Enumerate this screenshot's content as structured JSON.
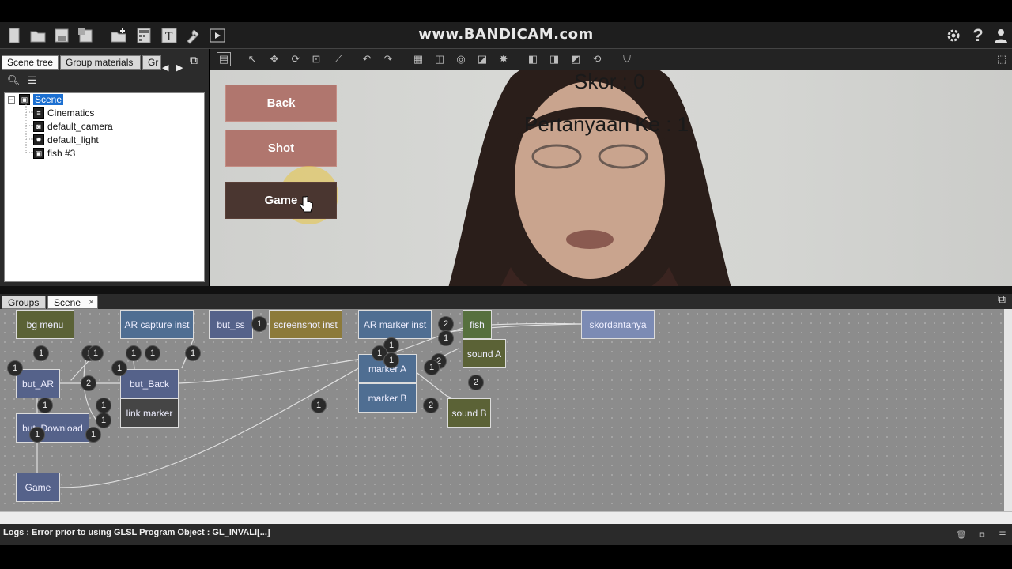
{
  "watermark": "www.BANDICAM.com",
  "toolbar": {
    "icons": [
      "new-file-icon",
      "open-folder-icon",
      "save-icon",
      "save-as-icon",
      "import-icon",
      "calculator-icon",
      "text-tool-icon",
      "wrench-icon",
      "play-icon"
    ],
    "right_icons": [
      "settings-icon",
      "help-icon",
      "user-icon"
    ]
  },
  "left_panel": {
    "tabs": [
      "Scene tree",
      "Group materials",
      "Gr"
    ],
    "tree": {
      "root": "Scene",
      "children": [
        "Cinematics",
        "default_camera",
        "default_light",
        "fish #3"
      ],
      "toggle": "−"
    }
  },
  "viewport": {
    "buttons": [
      "Back",
      "Shot",
      "Game"
    ],
    "score_text": "Skor : 0",
    "question_text": "Pertanyaan Ke : 1"
  },
  "graph": {
    "tabs": [
      "Groups",
      "Scene"
    ],
    "close_glyph": "×",
    "nodes": {
      "bg_menu": "bg menu",
      "ar_capture": "AR capture inst",
      "but_ss": "but_ss",
      "screenshot": "screenshot inst",
      "ar_marker": "AR marker inst",
      "fish": "fish",
      "skordantanya": "skordantanya",
      "sound_a": "sound A",
      "marker_a": "marker A",
      "marker_b": "marker B",
      "sound_b": "sound B",
      "but_ar": "but_AR",
      "but_back": "but_Back",
      "link_marker": "link marker",
      "but_download": "but_Download",
      "game": "Game"
    },
    "badges": [
      "1",
      "1",
      "1",
      "1",
      "1",
      "1",
      "2",
      "1",
      "1",
      "1",
      "1",
      "1",
      "1",
      "1",
      "1",
      "2",
      "1",
      "1",
      "1",
      "1",
      "2",
      "2",
      "2",
      "1",
      "1"
    ]
  },
  "status": {
    "log": "Logs : Error prior to using GLSL Program Object : GL_INVALI[...]"
  },
  "colors": {
    "button_rose": "#b0766e",
    "button_active": "#4a3630",
    "graph_bg": "#8c8c8c",
    "selection": "#1b6fd1"
  }
}
